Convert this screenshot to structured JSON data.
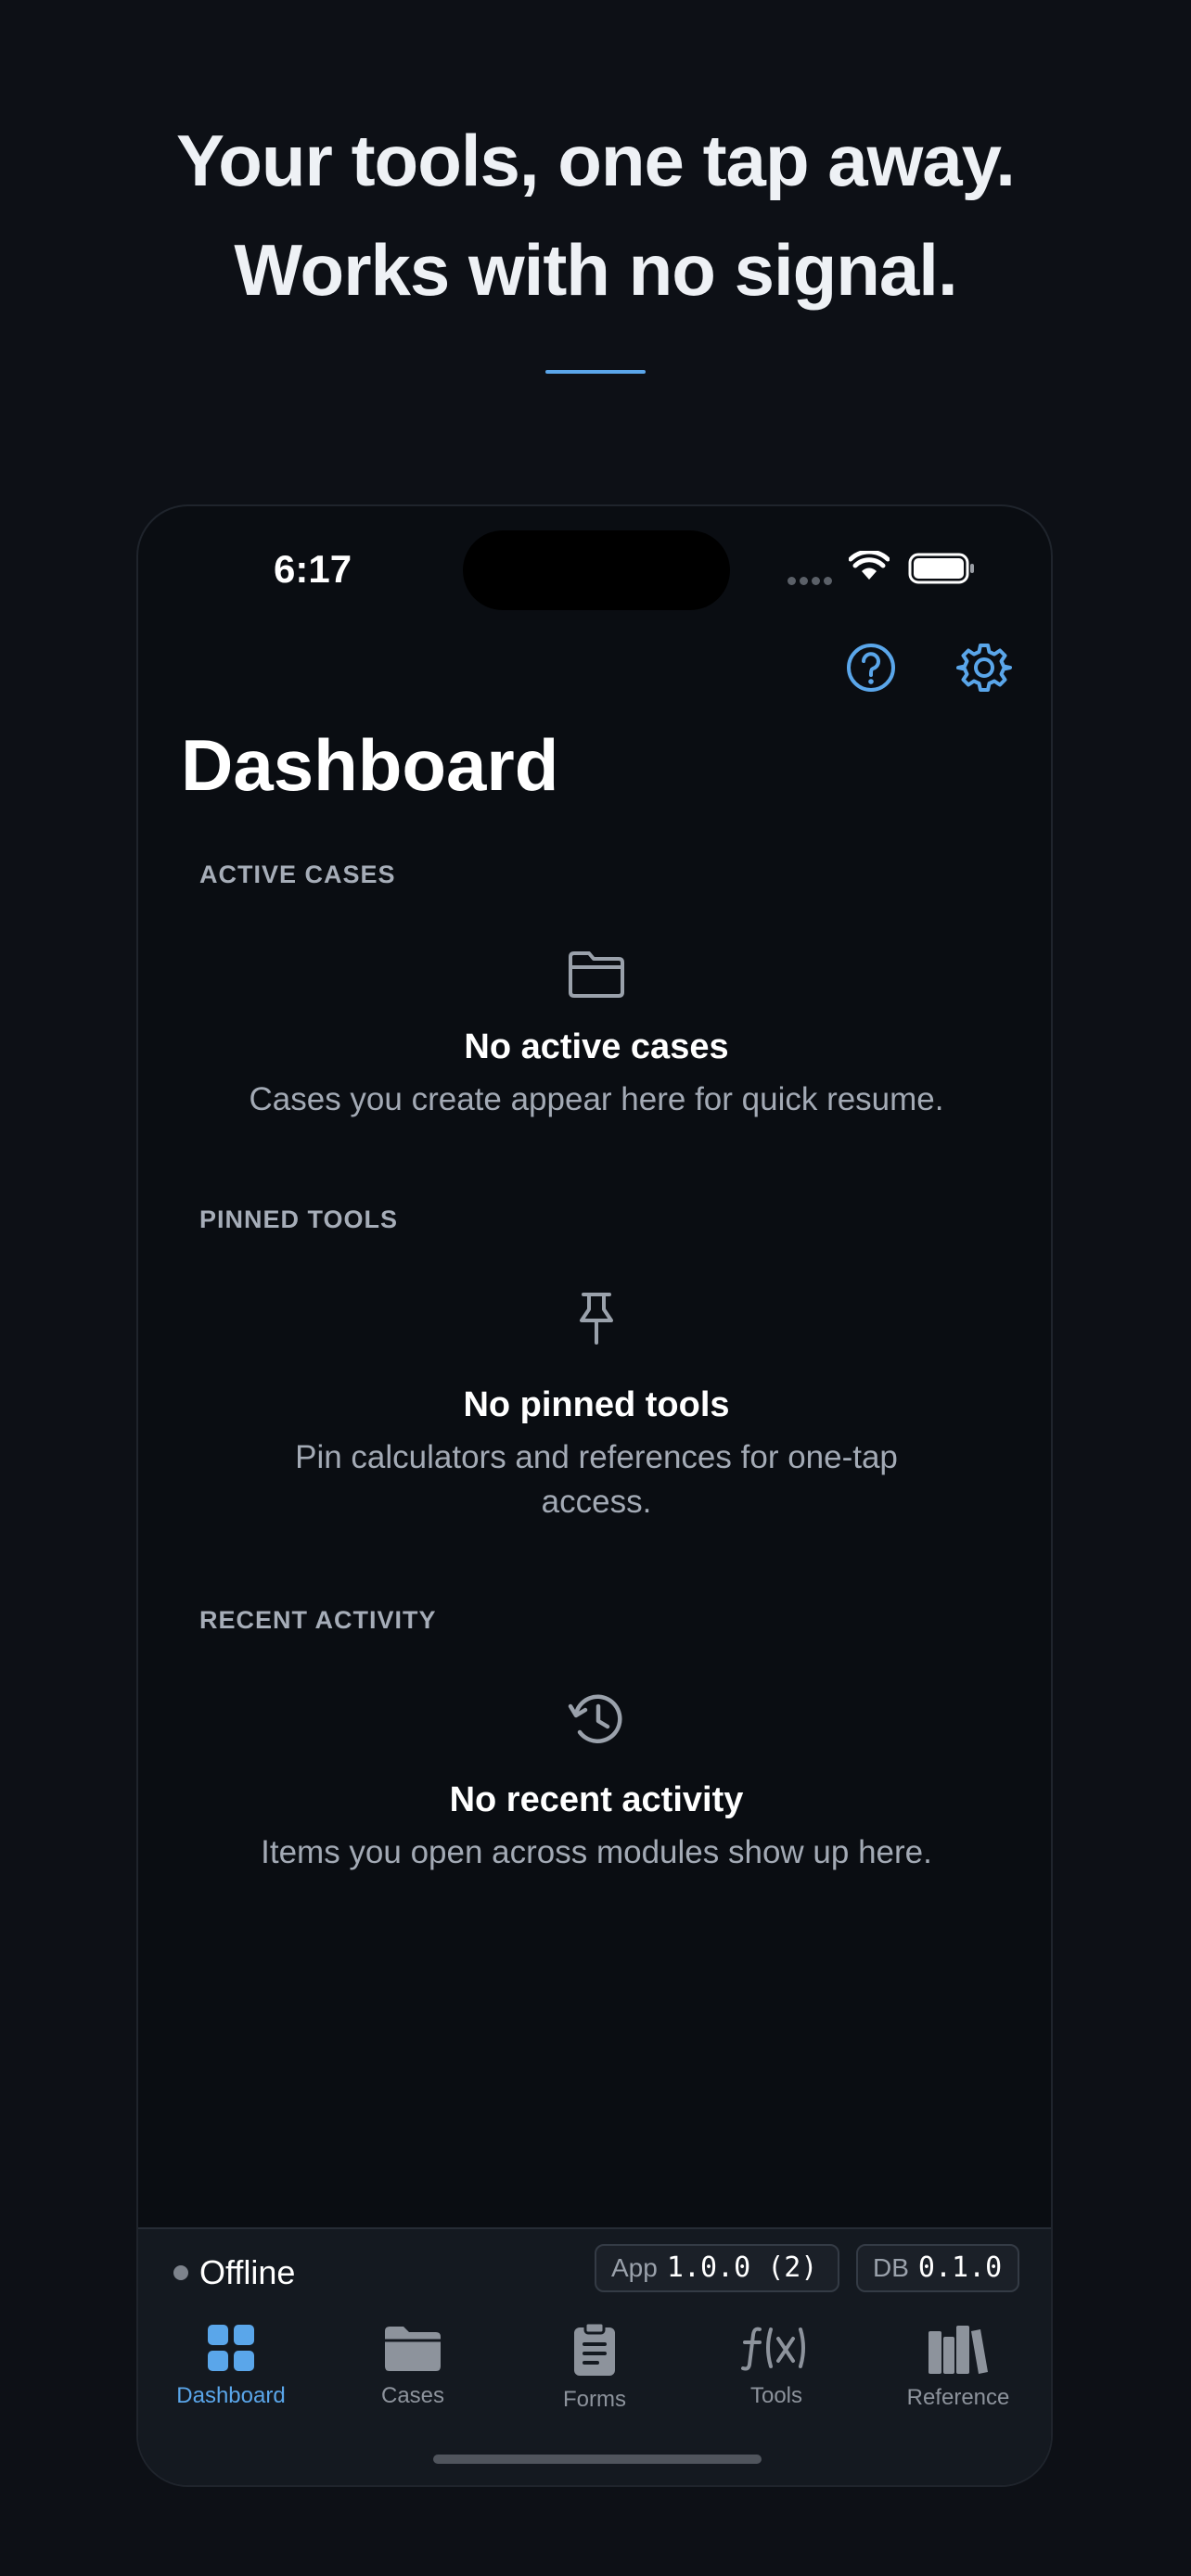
{
  "promo": {
    "line1": "Your tools, one tap away.",
    "line2": "Works with no signal.",
    "accent_color": "#5aa6ea"
  },
  "status_bar": {
    "time": "6:17",
    "icons": [
      "signal-dots-icon",
      "wifi-icon",
      "battery-icon"
    ]
  },
  "header": {
    "title": "Dashboard",
    "icons": [
      "help-circle-icon",
      "gear-icon"
    ]
  },
  "sections": {
    "active_cases": {
      "label": "ACTIVE CASES",
      "icon": "folder-icon",
      "empty_title": "No active cases",
      "empty_subtitle": "Cases you create appear here for quick resume."
    },
    "pinned_tools": {
      "label": "PINNED TOOLS",
      "icon": "pin-icon",
      "empty_title": "No pinned tools",
      "empty_subtitle": "Pin calculators and references for one-tap access."
    },
    "recent_activity": {
      "label": "RECENT ACTIVITY",
      "icon": "history-icon",
      "empty_title": "No recent activity",
      "empty_subtitle": "Items you open across modules show up here."
    }
  },
  "footer": {
    "status": "Offline",
    "app_label": "App",
    "app_version": "1.0.0 (2)",
    "db_label": "DB",
    "db_version": "0.1.0"
  },
  "tabs": [
    {
      "label": "Dashboard",
      "icon": "grid-icon",
      "active": true
    },
    {
      "label": "Cases",
      "icon": "folder-icon",
      "active": false
    },
    {
      "label": "Forms",
      "icon": "clipboard-icon",
      "active": false
    },
    {
      "label": "Tools",
      "icon": "function-icon",
      "active": false
    },
    {
      "label": "Reference",
      "icon": "books-icon",
      "active": false
    }
  ],
  "colors": {
    "background": "#0d1016",
    "screen": "#0a0d12",
    "accent": "#5aa6ea",
    "muted_text": "#a3aab5",
    "tab_inactive": "#8d939c"
  }
}
